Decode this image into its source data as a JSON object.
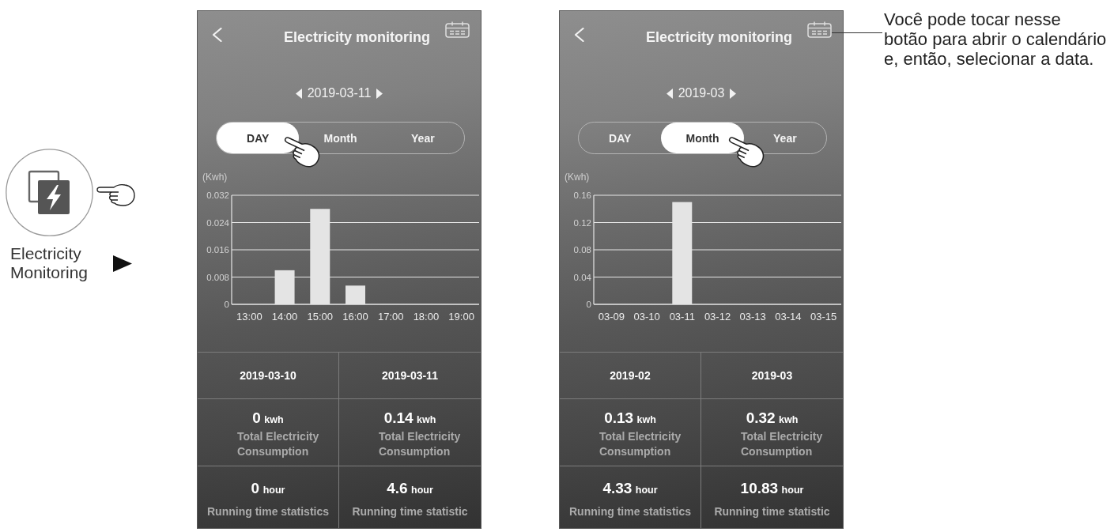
{
  "launcher": {
    "label": "Electricity\nMonitoring"
  },
  "screens": [
    {
      "title": "Electricity monitoring",
      "date": "2019-03-11",
      "tabs": [
        {
          "label": "DAY",
          "selected": true
        },
        {
          "label": "Month",
          "selected": false
        },
        {
          "label": "Year",
          "selected": false
        }
      ],
      "chart_data": {
        "type": "bar",
        "ylabel": "(Kwh)",
        "categories": [
          "13:00",
          "14:00",
          "15:00",
          "16:00",
          "17:00",
          "18:00",
          "19:00"
        ],
        "values": [
          0,
          0.01,
          0.028,
          0.0055,
          0,
          0,
          0
        ],
        "ylim": [
          0,
          0.032
        ],
        "yticks": [
          0,
          0.008,
          0.016,
          0.024,
          0.032
        ],
        "grid": true
      },
      "stats": [
        {
          "period": "2019-03-10",
          "consumption": "0",
          "consumption_unit": "kwh",
          "consumption_label": "Total Electricity Consumption",
          "runtime": "0",
          "runtime_unit": "hour",
          "runtime_label": "Running time statistics"
        },
        {
          "period": "2019-03-11",
          "consumption": "0.14",
          "consumption_unit": "kwh",
          "consumption_label": "Total Electricity Consumption",
          "runtime": "4.6",
          "runtime_unit": "hour",
          "runtime_label": "Running time statistic"
        }
      ]
    },
    {
      "title": "Electricity monitoring",
      "date": "2019-03",
      "tabs": [
        {
          "label": "DAY",
          "selected": false
        },
        {
          "label": "Month",
          "selected": true
        },
        {
          "label": "Year",
          "selected": false
        }
      ],
      "chart_data": {
        "type": "bar",
        "ylabel": "(Kwh)",
        "categories": [
          "03-09",
          "03-10",
          "03-11",
          "03-12",
          "03-13",
          "03-14",
          "03-15"
        ],
        "values": [
          0,
          0,
          0.15,
          0,
          0,
          0,
          0
        ],
        "ylim": [
          0,
          0.16
        ],
        "yticks": [
          0,
          0.04,
          0.08,
          0.12,
          0.16
        ],
        "grid": true
      },
      "stats": [
        {
          "period": "2019-02",
          "consumption": "0.13",
          "consumption_unit": "kwh",
          "consumption_label": "Total Electricity Consumption",
          "runtime": "4.33",
          "runtime_unit": "hour",
          "runtime_label": "Running time statistics"
        },
        {
          "period": "2019-03",
          "consumption": "0.32",
          "consumption_unit": "kwh",
          "consumption_label": "Total Electricity Consumption",
          "runtime": "10.83",
          "runtime_unit": "hour",
          "runtime_label": "Running time statistic"
        }
      ]
    }
  ],
  "annotation": {
    "text": "Você pode tocar nesse\nbotão para abrir o calendário\ne, então, selecionar a data."
  }
}
